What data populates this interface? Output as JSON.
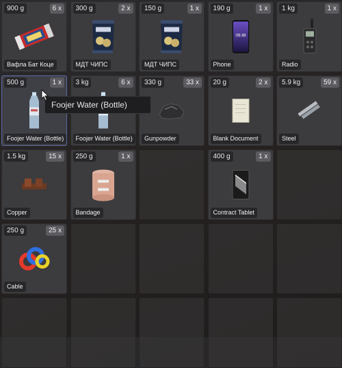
{
  "inventory": {
    "slots": [
      {
        "weight": "900 g",
        "count": "6 x",
        "name": "Вафла Бат Коце",
        "icon": "wafer-bar-icon"
      },
      {
        "weight": "300 g",
        "count": "2 x",
        "name": "МДТ ЧИПС",
        "icon": "chips-bag-icon"
      },
      {
        "weight": "150 g",
        "count": "1 x",
        "name": "МДТ ЧИПС",
        "icon": "chips-bag-icon"
      },
      {
        "weight": "190 g",
        "count": "1 x",
        "name": "Phone",
        "icon": "phone-icon"
      },
      {
        "weight": "1 kg",
        "count": "1 x",
        "name": "Radio",
        "icon": "radio-icon"
      },
      {
        "weight": "500 g",
        "count": "1 x",
        "name": "Foojer Water (Bottle)",
        "icon": "water-bottle-icon",
        "selected": true
      },
      {
        "weight": "3 kg",
        "count": "6 x",
        "name": "Foojer Water (Bottle)",
        "icon": "water-bottle-icon"
      },
      {
        "weight": "330 g",
        "count": "33 x",
        "name": "Gunpowder",
        "icon": "gunpowder-icon"
      },
      {
        "weight": "20 g",
        "count": "2 x",
        "name": "Blank Document",
        "icon": "document-icon"
      },
      {
        "weight": "5.9 kg",
        "count": "59 x",
        "name": "Steel",
        "icon": "steel-icon"
      },
      {
        "weight": "1.5 kg",
        "count": "15 x",
        "name": "Copper",
        "icon": "copper-icon"
      },
      {
        "weight": "250 g",
        "count": "1 x",
        "name": "Bandage",
        "icon": "bandage-icon"
      },
      null,
      {
        "weight": "400 g",
        "count": "1 x",
        "name": "Contract Tablet",
        "icon": "tablet-icon"
      },
      null,
      {
        "weight": "250 g",
        "count": "25 x",
        "name": "Cable",
        "icon": "cable-icon"
      },
      null,
      null,
      null,
      null,
      null,
      null,
      null,
      null,
      null
    ]
  },
  "tooltip": {
    "text": "Foojer Water (Bottle)"
  },
  "phone": {
    "time": "09:49"
  }
}
